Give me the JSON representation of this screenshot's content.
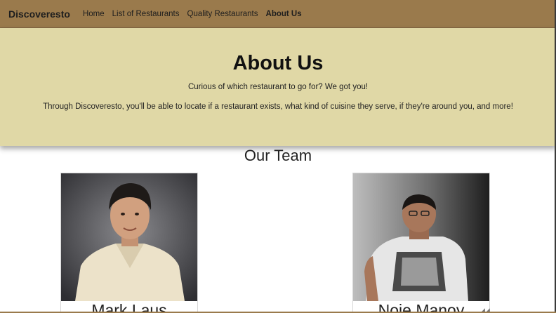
{
  "nav": {
    "brand": "Discoveresto",
    "links": [
      "Home",
      "List of Restaurants",
      "Quality Restaurants",
      "About Us"
    ]
  },
  "hero": {
    "title": "About Us",
    "tagline": "Curious of which restaurant to go for? We got you!",
    "description": "Through Discoveresto, you'll be able to locate if a restaurant exists, what kind of cuisine they serve, if they're around you, and more!"
  },
  "team": {
    "title": "Our Team",
    "members": [
      {
        "name": "Mark Laus"
      },
      {
        "name": "Noje Manoy"
      }
    ]
  },
  "colors": {
    "navbar": "#9a7a4c",
    "hero": "#e0d8a6"
  }
}
